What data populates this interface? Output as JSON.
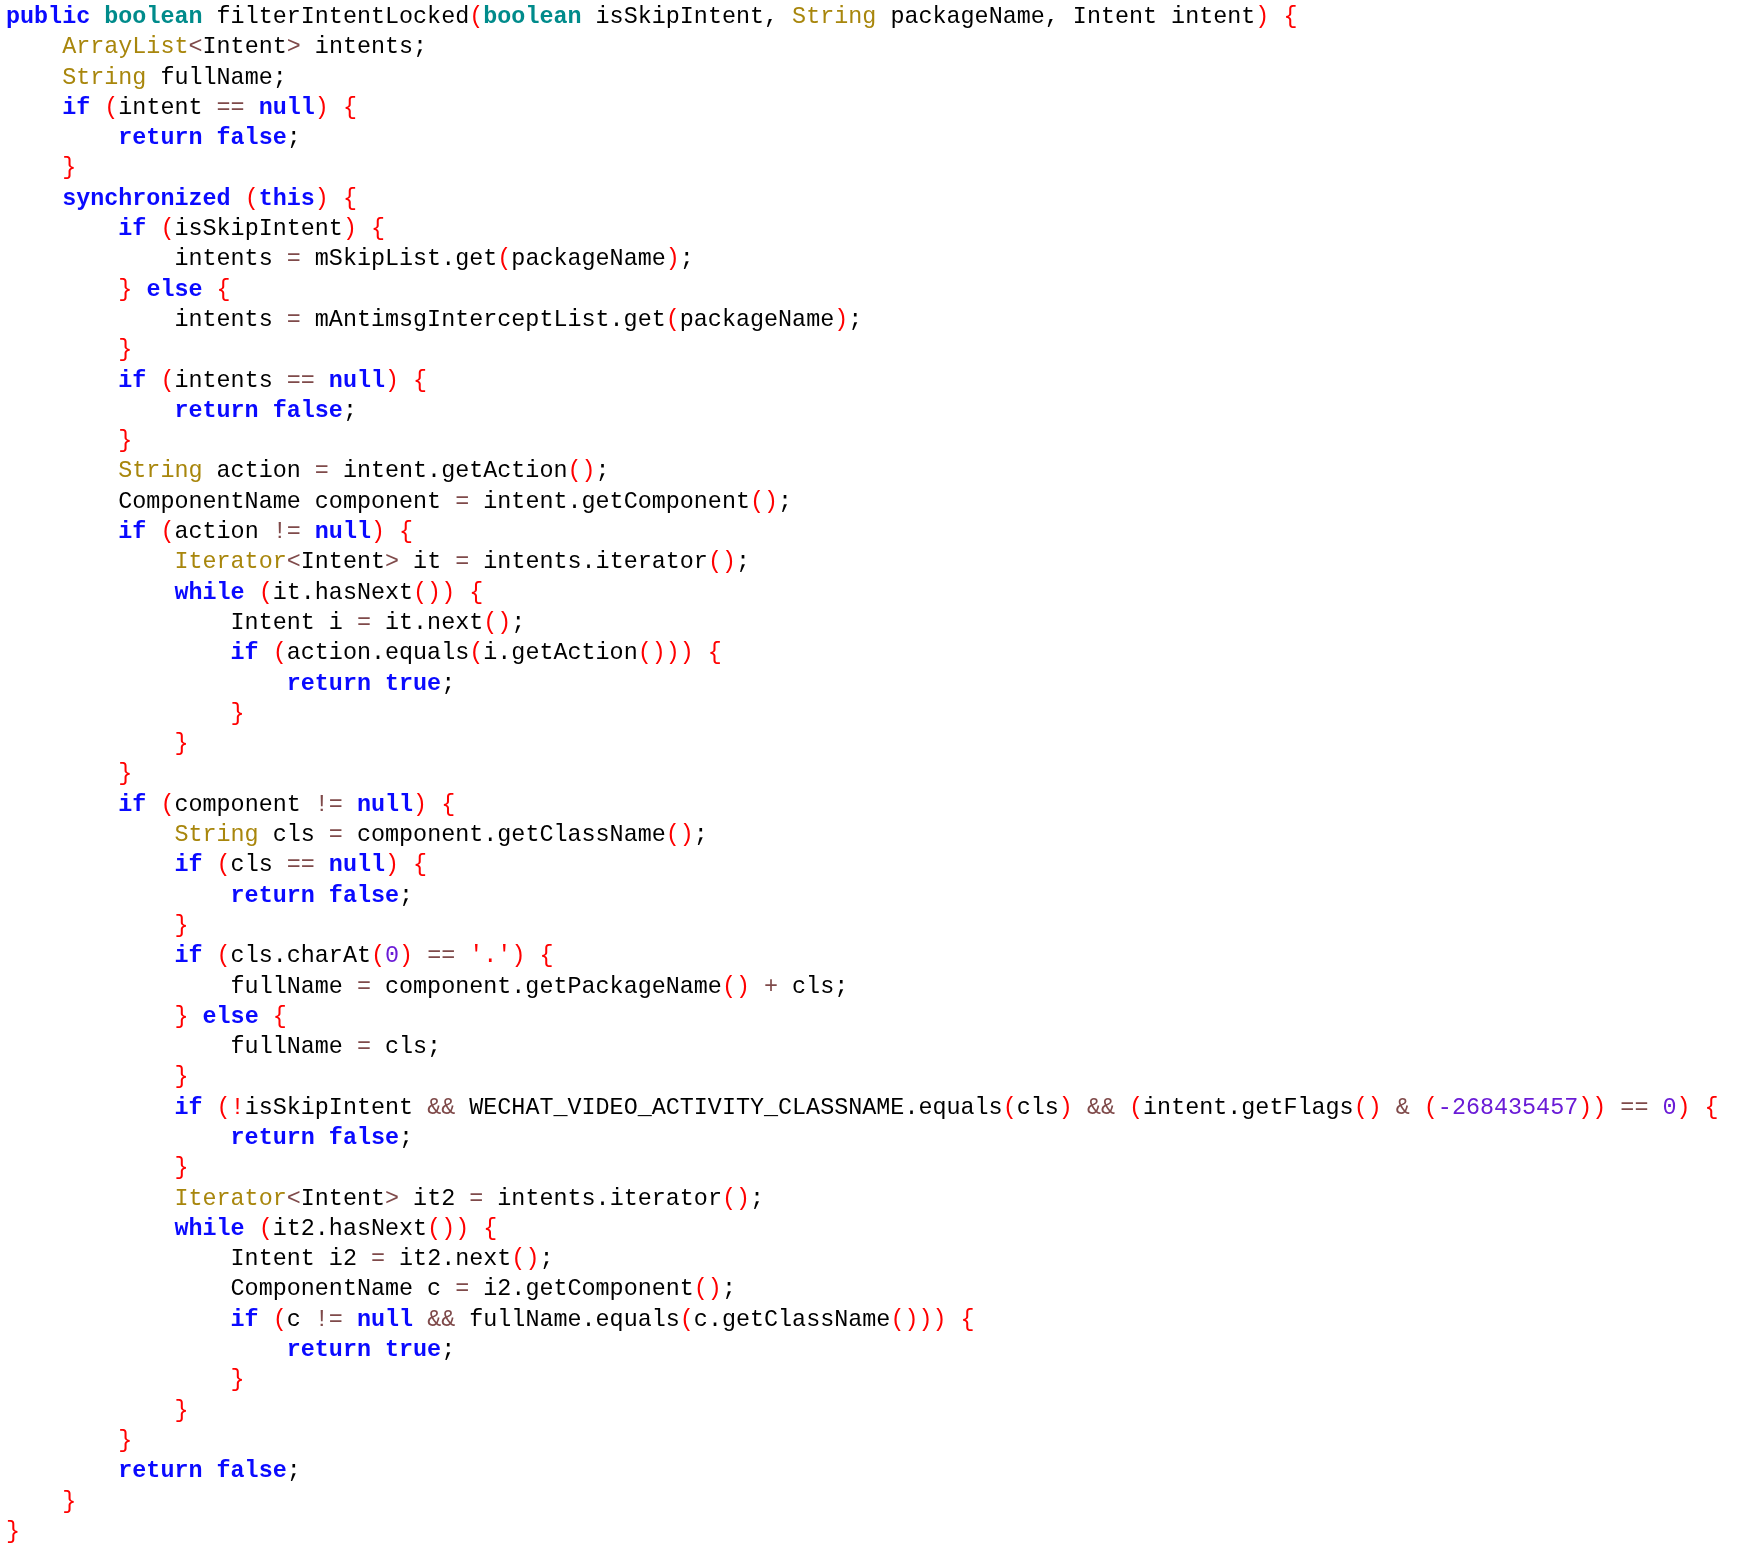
{
  "code": {
    "lines": [
      [
        {
          "kind": "kw",
          "text": "public"
        },
        {
          "kind": "prim",
          "text": " boolean"
        },
        {
          "kind": "txt",
          "text": " filterIntentLocked"
        },
        {
          "kind": "br",
          "text": "("
        },
        {
          "kind": "prim",
          "text": "boolean"
        },
        {
          "kind": "txt",
          "text": " isSkipIntent, "
        },
        {
          "kind": "type",
          "text": "String"
        },
        {
          "kind": "txt",
          "text": " packageName, Intent intent"
        },
        {
          "kind": "br",
          "text": ") {"
        }
      ],
      [
        {
          "kind": "type",
          "text": "    ArrayList"
        },
        {
          "kind": "op",
          "text": "<"
        },
        {
          "kind": "txt",
          "text": "Intent"
        },
        {
          "kind": "op",
          "text": ">"
        },
        {
          "kind": "txt",
          "text": " intents;"
        }
      ],
      [
        {
          "kind": "type",
          "text": "    String"
        },
        {
          "kind": "txt",
          "text": " fullName;"
        }
      ],
      [
        {
          "kind": "kw",
          "text": "    if"
        },
        {
          "kind": "br",
          "text": " ("
        },
        {
          "kind": "txt",
          "text": "intent "
        },
        {
          "kind": "op",
          "text": "=="
        },
        {
          "kind": "kw",
          "text": " null"
        },
        {
          "kind": "br",
          "text": ") {"
        }
      ],
      [
        {
          "kind": "kw",
          "text": "        return false"
        },
        {
          "kind": "txt",
          "text": ";"
        }
      ],
      [
        {
          "kind": "br",
          "text": "    }"
        }
      ],
      [
        {
          "kind": "kw",
          "text": "    synchronized"
        },
        {
          "kind": "br",
          "text": " ("
        },
        {
          "kind": "kw",
          "text": "this"
        },
        {
          "kind": "br",
          "text": ") {"
        }
      ],
      [
        {
          "kind": "kw",
          "text": "        if"
        },
        {
          "kind": "br",
          "text": " ("
        },
        {
          "kind": "txt",
          "text": "isSkipIntent"
        },
        {
          "kind": "br",
          "text": ") {"
        }
      ],
      [
        {
          "kind": "txt",
          "text": "            intents "
        },
        {
          "kind": "op",
          "text": "="
        },
        {
          "kind": "txt",
          "text": " mSkipList.get"
        },
        {
          "kind": "br",
          "text": "("
        },
        {
          "kind": "txt",
          "text": "packageName"
        },
        {
          "kind": "br",
          "text": ")"
        },
        {
          "kind": "txt",
          "text": ";"
        }
      ],
      [
        {
          "kind": "br",
          "text": "        }"
        },
        {
          "kind": "kw",
          "text": " else"
        },
        {
          "kind": "br",
          "text": " {"
        }
      ],
      [
        {
          "kind": "txt",
          "text": "            intents "
        },
        {
          "kind": "op",
          "text": "="
        },
        {
          "kind": "txt",
          "text": " mAntimsgInterceptList.get"
        },
        {
          "kind": "br",
          "text": "("
        },
        {
          "kind": "txt",
          "text": "packageName"
        },
        {
          "kind": "br",
          "text": ")"
        },
        {
          "kind": "txt",
          "text": ";"
        }
      ],
      [
        {
          "kind": "br",
          "text": "        }"
        }
      ],
      [
        {
          "kind": "kw",
          "text": "        if"
        },
        {
          "kind": "br",
          "text": " ("
        },
        {
          "kind": "txt",
          "text": "intents "
        },
        {
          "kind": "op",
          "text": "=="
        },
        {
          "kind": "kw",
          "text": " null"
        },
        {
          "kind": "br",
          "text": ") {"
        }
      ],
      [
        {
          "kind": "kw",
          "text": "            return false"
        },
        {
          "kind": "txt",
          "text": ";"
        }
      ],
      [
        {
          "kind": "br",
          "text": "        }"
        }
      ],
      [
        {
          "kind": "type",
          "text": "        String"
        },
        {
          "kind": "txt",
          "text": " action "
        },
        {
          "kind": "op",
          "text": "="
        },
        {
          "kind": "txt",
          "text": " intent.getAction"
        },
        {
          "kind": "br",
          "text": "()"
        },
        {
          "kind": "txt",
          "text": ";"
        }
      ],
      [
        {
          "kind": "txt",
          "text": "        ComponentName component "
        },
        {
          "kind": "op",
          "text": "="
        },
        {
          "kind": "txt",
          "text": " intent.getComponent"
        },
        {
          "kind": "br",
          "text": "()"
        },
        {
          "kind": "txt",
          "text": ";"
        }
      ],
      [
        {
          "kind": "kw",
          "text": "        if"
        },
        {
          "kind": "br",
          "text": " ("
        },
        {
          "kind": "txt",
          "text": "action "
        },
        {
          "kind": "op",
          "text": "!="
        },
        {
          "kind": "kw",
          "text": " null"
        },
        {
          "kind": "br",
          "text": ") {"
        }
      ],
      [
        {
          "kind": "type",
          "text": "            Iterator"
        },
        {
          "kind": "op",
          "text": "<"
        },
        {
          "kind": "txt",
          "text": "Intent"
        },
        {
          "kind": "op",
          "text": ">"
        },
        {
          "kind": "txt",
          "text": " it "
        },
        {
          "kind": "op",
          "text": "="
        },
        {
          "kind": "txt",
          "text": " intents.iterator"
        },
        {
          "kind": "br",
          "text": "()"
        },
        {
          "kind": "txt",
          "text": ";"
        }
      ],
      [
        {
          "kind": "kw",
          "text": "            while"
        },
        {
          "kind": "br",
          "text": " ("
        },
        {
          "kind": "txt",
          "text": "it.hasNext"
        },
        {
          "kind": "br",
          "text": "()) {"
        }
      ],
      [
        {
          "kind": "txt",
          "text": "                Intent i "
        },
        {
          "kind": "op",
          "text": "="
        },
        {
          "kind": "txt",
          "text": " it.next"
        },
        {
          "kind": "br",
          "text": "()"
        },
        {
          "kind": "txt",
          "text": ";"
        }
      ],
      [
        {
          "kind": "kw",
          "text": "                if"
        },
        {
          "kind": "br",
          "text": " ("
        },
        {
          "kind": "txt",
          "text": "action.equals"
        },
        {
          "kind": "br",
          "text": "("
        },
        {
          "kind": "txt",
          "text": "i.getAction"
        },
        {
          "kind": "br",
          "text": "())) {"
        }
      ],
      [
        {
          "kind": "kw",
          "text": "                    return true"
        },
        {
          "kind": "txt",
          "text": ";"
        }
      ],
      [
        {
          "kind": "br",
          "text": "                }"
        }
      ],
      [
        {
          "kind": "br",
          "text": "            }"
        }
      ],
      [
        {
          "kind": "br",
          "text": "        }"
        }
      ],
      [
        {
          "kind": "kw",
          "text": "        if"
        },
        {
          "kind": "br",
          "text": " ("
        },
        {
          "kind": "txt",
          "text": "component "
        },
        {
          "kind": "op",
          "text": "!="
        },
        {
          "kind": "kw",
          "text": " null"
        },
        {
          "kind": "br",
          "text": ") {"
        }
      ],
      [
        {
          "kind": "type",
          "text": "            String"
        },
        {
          "kind": "txt",
          "text": " cls "
        },
        {
          "kind": "op",
          "text": "="
        },
        {
          "kind": "txt",
          "text": " component.getClassName"
        },
        {
          "kind": "br",
          "text": "()"
        },
        {
          "kind": "txt",
          "text": ";"
        }
      ],
      [
        {
          "kind": "kw",
          "text": "            if"
        },
        {
          "kind": "br",
          "text": " ("
        },
        {
          "kind": "txt",
          "text": "cls "
        },
        {
          "kind": "op",
          "text": "=="
        },
        {
          "kind": "kw",
          "text": " null"
        },
        {
          "kind": "br",
          "text": ") {"
        }
      ],
      [
        {
          "kind": "kw",
          "text": "                return false"
        },
        {
          "kind": "txt",
          "text": ";"
        }
      ],
      [
        {
          "kind": "br",
          "text": "            }"
        }
      ],
      [
        {
          "kind": "kw",
          "text": "            if"
        },
        {
          "kind": "br",
          "text": " ("
        },
        {
          "kind": "txt",
          "text": "cls.charAt"
        },
        {
          "kind": "br",
          "text": "("
        },
        {
          "kind": "num",
          "text": "0"
        },
        {
          "kind": "br",
          "text": ")"
        },
        {
          "kind": "op",
          "text": " =="
        },
        {
          "kind": "str",
          "text": " '.'"
        },
        {
          "kind": "br",
          "text": ") {"
        }
      ],
      [
        {
          "kind": "txt",
          "text": "                fullName "
        },
        {
          "kind": "op",
          "text": "="
        },
        {
          "kind": "txt",
          "text": " component.getPackageName"
        },
        {
          "kind": "br",
          "text": "()"
        },
        {
          "kind": "op",
          "text": " +"
        },
        {
          "kind": "txt",
          "text": " cls;"
        }
      ],
      [
        {
          "kind": "br",
          "text": "            }"
        },
        {
          "kind": "kw",
          "text": " else"
        },
        {
          "kind": "br",
          "text": " {"
        }
      ],
      [
        {
          "kind": "txt",
          "text": "                fullName "
        },
        {
          "kind": "op",
          "text": "="
        },
        {
          "kind": "txt",
          "text": " cls;"
        }
      ],
      [
        {
          "kind": "br",
          "text": "            }"
        }
      ],
      [
        {
          "kind": "kw",
          "text": "            if"
        },
        {
          "kind": "br",
          "text": " (!"
        },
        {
          "kind": "txt",
          "text": "isSkipIntent "
        },
        {
          "kind": "op",
          "text": "&&"
        },
        {
          "kind": "txt",
          "text": " WECHAT_VIDEO_ACTIVITY_CLASSNAME.equals"
        },
        {
          "kind": "br",
          "text": "("
        },
        {
          "kind": "txt",
          "text": "cls"
        },
        {
          "kind": "br",
          "text": ")"
        },
        {
          "kind": "op",
          "text": " &&"
        },
        {
          "kind": "br",
          "text": " ("
        },
        {
          "kind": "txt",
          "text": "intent.getFlags"
        },
        {
          "kind": "br",
          "text": "()"
        },
        {
          "kind": "op",
          "text": " &"
        },
        {
          "kind": "br",
          "text": " ("
        },
        {
          "kind": "num",
          "text": "-268435457"
        },
        {
          "kind": "br",
          "text": "))"
        },
        {
          "kind": "op",
          "text": " =="
        },
        {
          "kind": "num",
          "text": " 0"
        },
        {
          "kind": "br",
          "text": ") {"
        }
      ],
      [
        {
          "kind": "kw",
          "text": "                return false"
        },
        {
          "kind": "txt",
          "text": ";"
        }
      ],
      [
        {
          "kind": "br",
          "text": "            }"
        }
      ],
      [
        {
          "kind": "type",
          "text": "            Iterator"
        },
        {
          "kind": "op",
          "text": "<"
        },
        {
          "kind": "txt",
          "text": "Intent"
        },
        {
          "kind": "op",
          "text": ">"
        },
        {
          "kind": "txt",
          "text": " it2 "
        },
        {
          "kind": "op",
          "text": "="
        },
        {
          "kind": "txt",
          "text": " intents.iterator"
        },
        {
          "kind": "br",
          "text": "()"
        },
        {
          "kind": "txt",
          "text": ";"
        }
      ],
      [
        {
          "kind": "kw",
          "text": "            while"
        },
        {
          "kind": "br",
          "text": " ("
        },
        {
          "kind": "txt",
          "text": "it2.hasNext"
        },
        {
          "kind": "br",
          "text": "()) {"
        }
      ],
      [
        {
          "kind": "txt",
          "text": "                Intent i2 "
        },
        {
          "kind": "op",
          "text": "="
        },
        {
          "kind": "txt",
          "text": " it2.next"
        },
        {
          "kind": "br",
          "text": "()"
        },
        {
          "kind": "txt",
          "text": ";"
        }
      ],
      [
        {
          "kind": "txt",
          "text": "                ComponentName c "
        },
        {
          "kind": "op",
          "text": "="
        },
        {
          "kind": "txt",
          "text": " i2.getComponent"
        },
        {
          "kind": "br",
          "text": "()"
        },
        {
          "kind": "txt",
          "text": ";"
        }
      ],
      [
        {
          "kind": "kw",
          "text": "                if"
        },
        {
          "kind": "br",
          "text": " ("
        },
        {
          "kind": "txt",
          "text": "c "
        },
        {
          "kind": "op",
          "text": "!="
        },
        {
          "kind": "kw",
          "text": " null"
        },
        {
          "kind": "op",
          "text": " &&"
        },
        {
          "kind": "txt",
          "text": " fullName.equals"
        },
        {
          "kind": "br",
          "text": "("
        },
        {
          "kind": "txt",
          "text": "c.getClassName"
        },
        {
          "kind": "br",
          "text": "())) {"
        }
      ],
      [
        {
          "kind": "kw",
          "text": "                    return true"
        },
        {
          "kind": "txt",
          "text": ";"
        }
      ],
      [
        {
          "kind": "br",
          "text": "                }"
        }
      ],
      [
        {
          "kind": "br",
          "text": "            }"
        }
      ],
      [
        {
          "kind": "br",
          "text": "        }"
        }
      ],
      [
        {
          "kind": "kw",
          "text": "        return false"
        },
        {
          "kind": "txt",
          "text": ";"
        }
      ],
      [
        {
          "kind": "br",
          "text": "    }"
        }
      ],
      [
        {
          "kind": "br",
          "text": "}"
        }
      ]
    ]
  }
}
